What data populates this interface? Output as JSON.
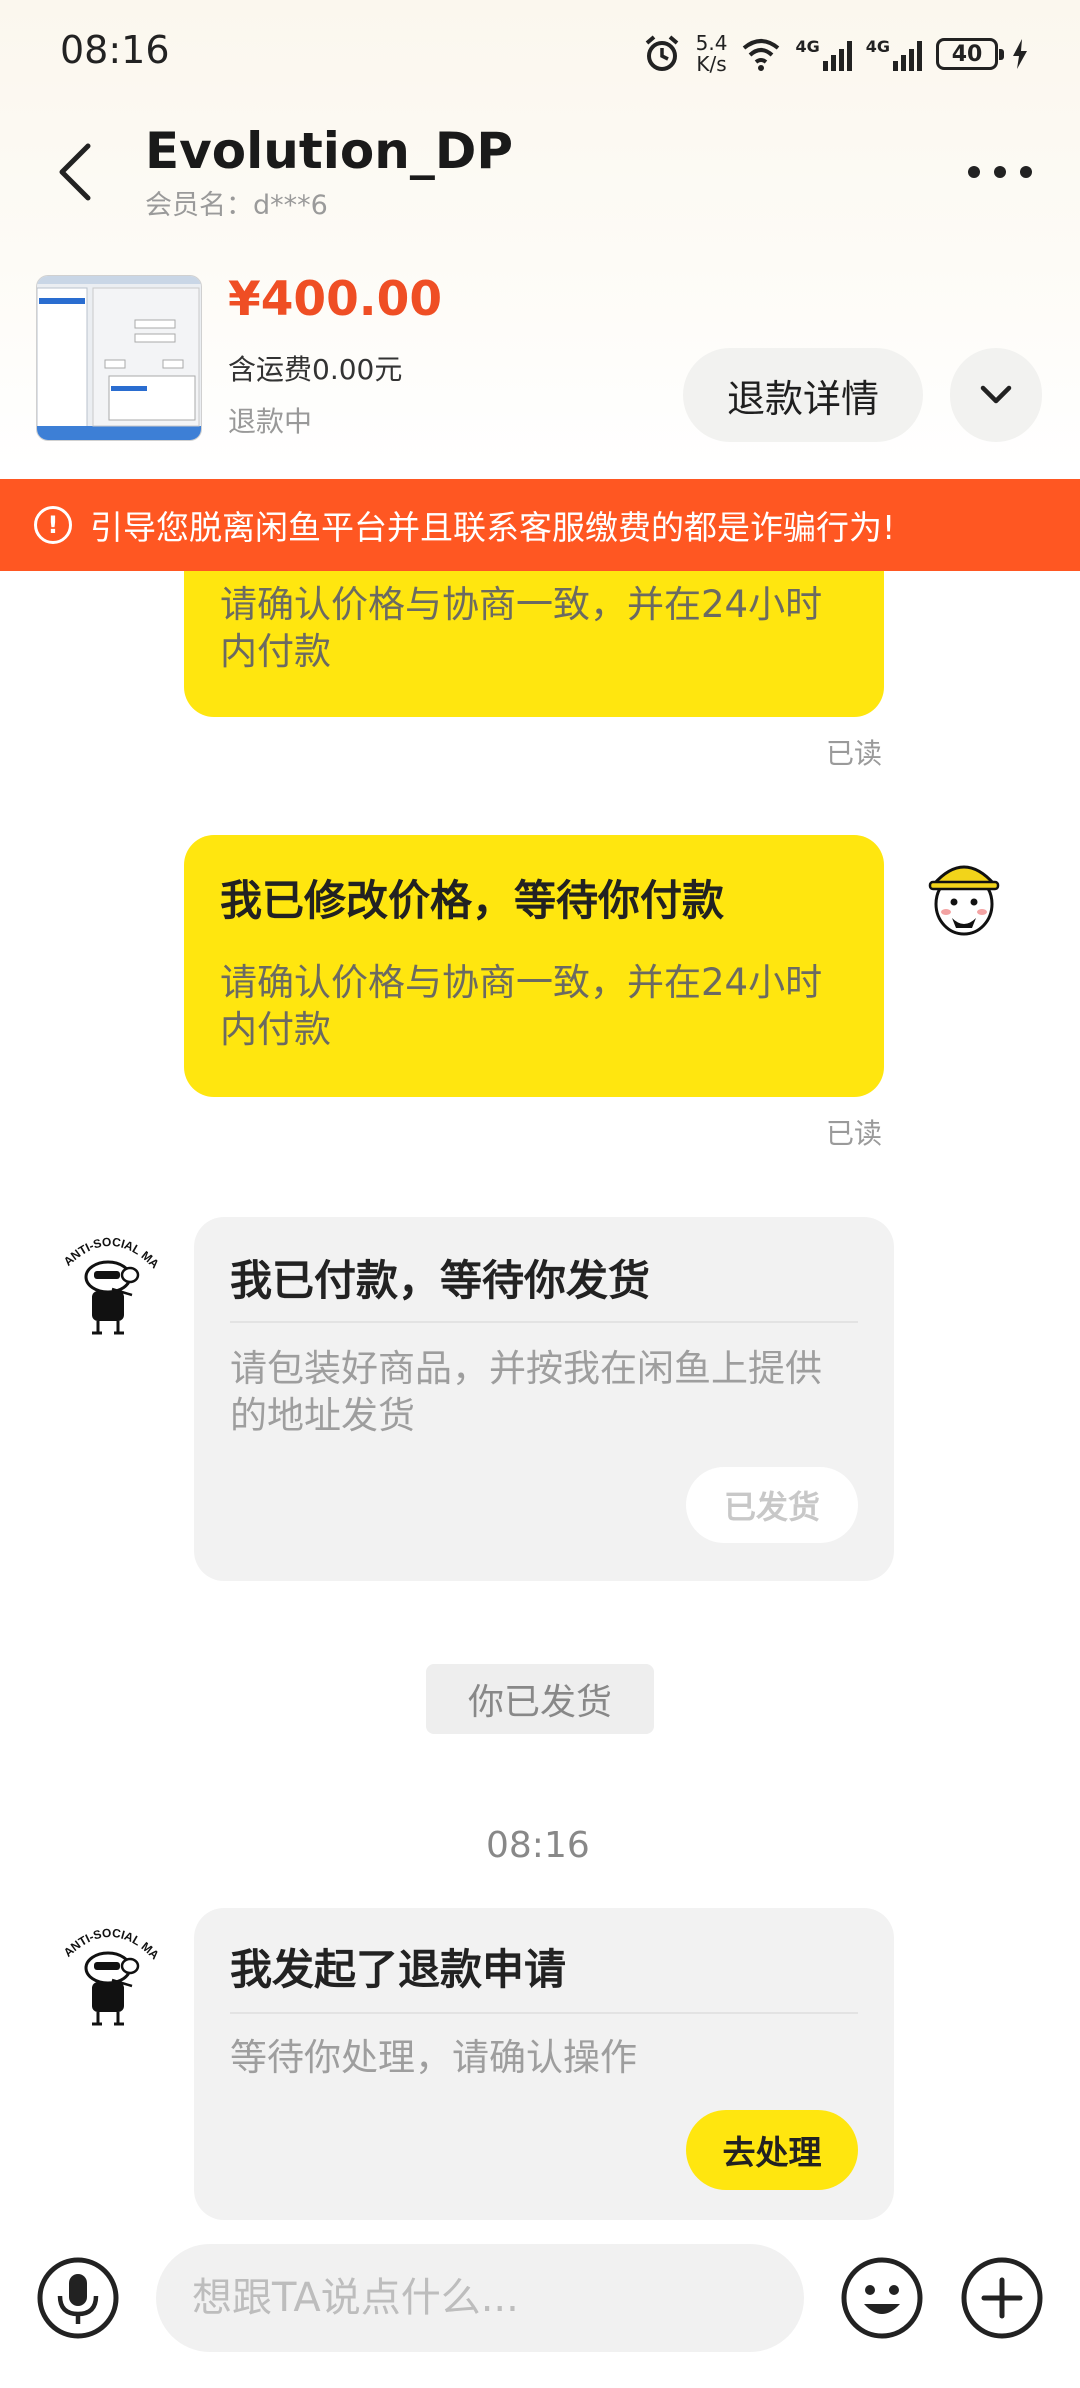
{
  "status_bar": {
    "time": "08:16",
    "net_speed_value": "5.4",
    "net_speed_unit": "K/s",
    "signal_1": "4G",
    "signal_2": "4G",
    "battery": "40"
  },
  "header": {
    "title": "Evolution_DP",
    "member_name": "会员名：d***6"
  },
  "product": {
    "price": "¥400.00",
    "shipping": "含运费0.00元",
    "status": "退款中",
    "refund_detail_label": "退款详情"
  },
  "warning": {
    "text": "引导您脱离闲鱼平台并且联系客服缴费的都是诈骗行为!"
  },
  "messages": {
    "m1": {
      "sub": "请确认价格与协商一致，并在24小时内付款",
      "read": "已读"
    },
    "m2": {
      "title": "我已修改价格，等待你付款",
      "sub": "请确认价格与协商一致，并在24小时内付款",
      "read": "已读"
    },
    "m3": {
      "title": "我已付款，等待你发货",
      "sub": "请包装好商品，并按我在闲鱼上提供的地址发货",
      "button": "已发货"
    },
    "system_notice": "你已发货",
    "timestamp": "08:16",
    "m4": {
      "title": "我发起了退款申请",
      "sub": "等待你处理，请确认操作",
      "button": "去处理"
    },
    "buyer_avatar_text": "ANTI-SOCIAL MAN"
  },
  "input": {
    "placeholder": "想跟TA说点什么..."
  },
  "colors": {
    "accent_yellow": "#ffe60f",
    "price_red": "#ef4e24",
    "warning_orange": "#ff5722"
  }
}
